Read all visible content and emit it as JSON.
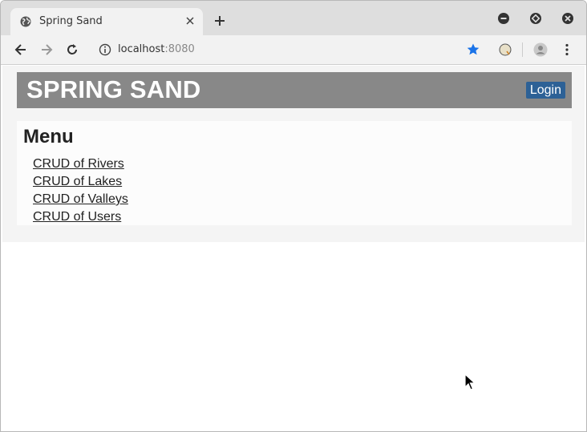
{
  "browser": {
    "tab_title": "Spring Sand",
    "url_host": "localhost",
    "url_port": ":8080"
  },
  "header": {
    "brand": "SPRING SAND",
    "login_label": "Login"
  },
  "menu": {
    "title": "Menu",
    "items": [
      {
        "label": "CRUD of Rivers"
      },
      {
        "label": "CRUD of Lakes"
      },
      {
        "label": "CRUD of Valleys"
      },
      {
        "label": "CRUD of Users"
      }
    ]
  },
  "colors": {
    "banner": "#888888",
    "login_button": "#2d6196",
    "bookmark_star": "#1a73e8"
  }
}
